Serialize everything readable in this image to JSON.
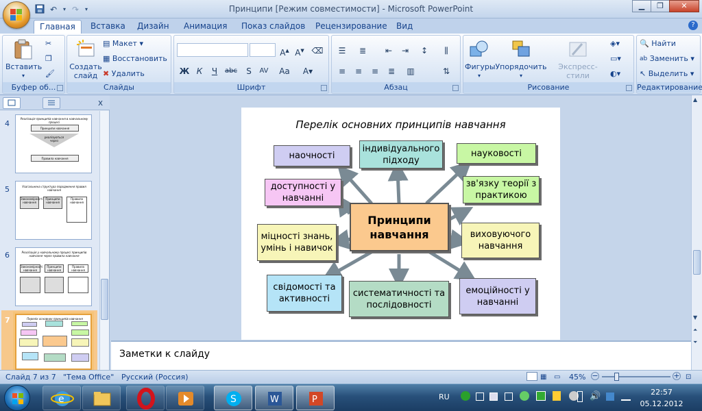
{
  "window": {
    "title": "Принципи [Режим совместимости] - Microsoft PowerPoint"
  },
  "tabs": [
    "Главная",
    "Вставка",
    "Дизайн",
    "Анимация",
    "Показ слайдов",
    "Рецензирование",
    "Вид"
  ],
  "ribbon": {
    "clipboard": {
      "label": "Буфер об...",
      "paste": "Вставить"
    },
    "slides": {
      "label": "Слайды",
      "create": "Создать слайд",
      "layout": "Макет",
      "restore": "Восстановить",
      "delete": "Удалить"
    },
    "font": {
      "label": "Шрифт"
    },
    "paragraph": {
      "label": "Абзац"
    },
    "drawing": {
      "label": "Рисование",
      "shapes": "Фигуры",
      "arrange": "Упорядочить",
      "styles": "Экспресс-стили"
    },
    "editing": {
      "label": "Редактирование",
      "find": "Найти",
      "replace": "Заменить",
      "select": "Выделить"
    }
  },
  "thumbnails": [
    {
      "num": "4",
      "title": "Реалізація принципів навчання в навчальному процесі",
      "lines": [
        "Принципи навчання",
        "реалізуються через",
        "Правила навчання"
      ]
    },
    {
      "num": "5",
      "title": "Узагальнена структура породження правил навчання",
      "lines": [
        "Закономірності навчання",
        "Принципи навчання",
        "Правила навчання"
      ]
    },
    {
      "num": "6",
      "title": "Реалізація у навчальному процесі принципів навчання через правила навчання",
      "lines": [
        "Закономірності навчання",
        "Принципи навчання",
        "Правила навчання"
      ]
    },
    {
      "num": "7",
      "title": "Перелік основних принципів навчання",
      "lines": []
    }
  ],
  "slide": {
    "title": "Перелік основних принципів навчання",
    "center": "Принципи навчання",
    "boxes": {
      "b1": "наочності",
      "b2": "індивідуального підходу",
      "b3": "науковості",
      "b4": "доступності у навчанні",
      "b5": "зв'язку теорії з практикою",
      "b6": "міцності знань, умінь і навичок",
      "b7": "виховуючого навчання",
      "b8": "свідомості та активності",
      "b9": "систематичності та послідовності",
      "b10": "емоційності у навчанні"
    },
    "colors": {
      "lavender": "#cfcdf2",
      "teal": "#a9e2dc",
      "green": "#c8f7a4",
      "pink": "#f6c6f4",
      "yellow": "#f7f5b8",
      "orange": "#fbc98e",
      "blue": "#b5e4f7",
      "gray": "#b4dcc5",
      "arrow": "#7a8a94"
    }
  },
  "notes": {
    "placeholder": "Заметки к слайду"
  },
  "status": {
    "slide": "Слайд 7 из 7",
    "theme": "\"Тема Office\"",
    "lang": "Русский (Россия)",
    "zoom": "45%"
  },
  "taskbar": {
    "lang": "RU",
    "time": "22:57",
    "date": "05.12.2012"
  }
}
